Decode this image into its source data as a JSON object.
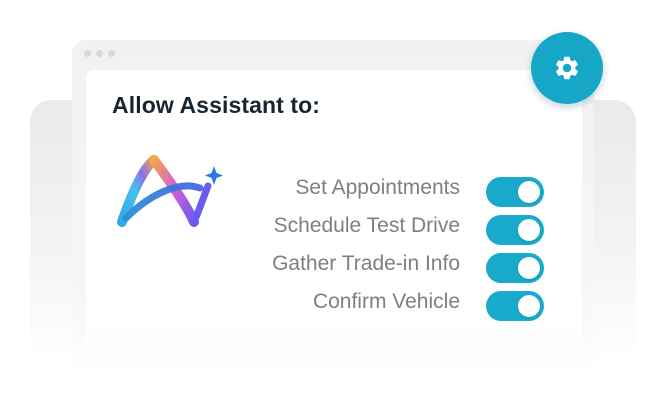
{
  "window": {
    "controls": [
      "dot",
      "dot",
      "dot"
    ]
  },
  "panel": {
    "title": "Allow Assistant to:"
  },
  "permissions": [
    {
      "label": "Set Appointments",
      "enabled": true
    },
    {
      "label": "Schedule Test Drive",
      "enabled": true
    },
    {
      "label": "Gather Trade-in Info",
      "enabled": true
    },
    {
      "label": "Confirm Vehicle",
      "enabled": true
    }
  ],
  "icons": {
    "settings": "gear-icon",
    "logo": "assistant-logo"
  },
  "colors": {
    "accent": "#19aacb",
    "title": "#172532",
    "label": "#7d7f83",
    "logo_gradient": [
      "#3fb2e6",
      "#7a6cf0",
      "#c45be0",
      "#f5a54a"
    ]
  }
}
